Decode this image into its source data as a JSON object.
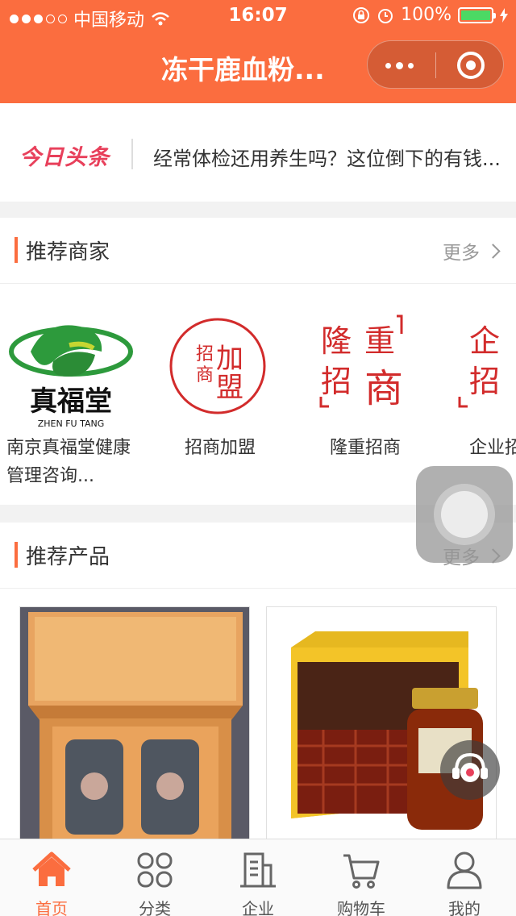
{
  "status_bar": {
    "carrier": "中国移动",
    "time": "16:07",
    "battery": "100%"
  },
  "nav": {
    "title": "冻干鹿血粉..."
  },
  "headline": {
    "brand": "今日头条",
    "text": "经常体检还用养生吗？这位倒下的有钱..."
  },
  "merchants": {
    "title": "推荐商家",
    "more": "更多",
    "items": [
      {
        "name": "南京真福堂健康管理咨询...",
        "logo_text": "真福堂",
        "logo_sub": "ZHEN FU TANG"
      },
      {
        "name": "招商加盟",
        "logo_text": "招商加盟"
      },
      {
        "name": "隆重招商",
        "logo_text": "隆重招商"
      },
      {
        "name": "企业招",
        "logo_text": "企业招"
      }
    ]
  },
  "products": {
    "title": "推荐产品",
    "more": "更多"
  },
  "tabbar": {
    "items": [
      {
        "label": "首页"
      },
      {
        "label": "分类"
      },
      {
        "label": "企业"
      },
      {
        "label": "购物车"
      },
      {
        "label": "我的"
      }
    ]
  },
  "colors": {
    "primary": "#fb6d3f",
    "toutiao": "#e8405b",
    "logo_green": "#2d9a3c",
    "logo_red": "#d22b2b"
  }
}
